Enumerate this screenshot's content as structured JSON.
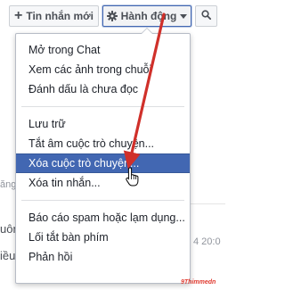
{
  "toolbar": {
    "new_message_label": "Tin nhắn mới",
    "new_message_icon": "plus-icon",
    "actions_label": "Hành động",
    "actions_icon": "gear-icon",
    "search_icon": "search-icon"
  },
  "menu": {
    "group1": [
      {
        "label": "Mở trong Chat"
      },
      {
        "label": "Xem các ảnh trong chuỗi"
      },
      {
        "label": "Đánh dấu là chưa đọc"
      }
    ],
    "group2": [
      {
        "label": "Lưu trữ"
      },
      {
        "label": "Tắt âm cuộc trò chuyện..."
      },
      {
        "label": "Xóa cuộc trò chuyện...",
        "highlighted": true
      },
      {
        "label": "Xóa tin nhắn..."
      }
    ],
    "group3": [
      {
        "label": "Báo cáo spam hoặc lạm dụng..."
      },
      {
        "label": "Lối tắt bàn phím"
      },
      {
        "label": "Phản hồi"
      }
    ]
  },
  "background": {
    "left_fragment_1": "ăng",
    "timestamp_fragment": "4 20:0",
    "left_fragment_2": "uôn",
    "left_fragment_3": "iều"
  },
  "colors": {
    "accent": "#4267b2",
    "annotation_arrow": "#d0302a"
  },
  "watermark": "9Thimmedn"
}
